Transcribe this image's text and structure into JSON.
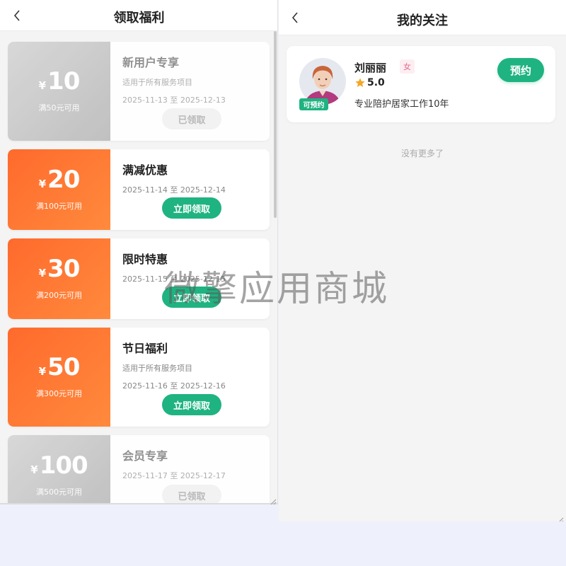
{
  "benefits_page": {
    "title": "领取福利",
    "coupons": [
      {
        "yen": "¥",
        "amount": "10",
        "condition": "满50元可用",
        "name": "新用户专享",
        "desc": "适用于所有服务项目",
        "date": "2025-11-13 至 2025-12-13",
        "button": "已领取",
        "state": "claimed"
      },
      {
        "yen": "¥",
        "amount": "20",
        "condition": "满100元可用",
        "name": "满减优惠",
        "desc": "",
        "date": "2025-11-14 至 2025-12-14",
        "button": "立即领取",
        "state": "active"
      },
      {
        "yen": "¥",
        "amount": "30",
        "condition": "满200元可用",
        "name": "限时特惠",
        "desc": "",
        "date": "2025-11-15 至 2025-12-15",
        "button": "立即领取",
        "state": "active"
      },
      {
        "yen": "¥",
        "amount": "50",
        "condition": "满300元可用",
        "name": "节日福利",
        "desc": "适用于所有服务项目",
        "date": "2025-11-16 至 2025-12-16",
        "button": "立即领取",
        "state": "active"
      },
      {
        "yen": "¥",
        "amount": "100",
        "condition": "满500元可用",
        "name": "会员专享",
        "desc": "",
        "date": "2025-11-17 至 2025-12-17",
        "button": "已领取",
        "state": "claimed"
      }
    ]
  },
  "follow_page": {
    "title": "我的关注",
    "card": {
      "name": "刘丽丽",
      "gender": "女",
      "rating": "5.0",
      "intro": "专业陪护居家工作10年",
      "badge": "可预约",
      "book_button": "预约"
    },
    "no_more": "没有更多了"
  },
  "watermark": "微擎应用商城",
  "colors": {
    "accent_green": "#1fb381",
    "coupon_orange": "#ff6a2c",
    "claimed_gray": "#c8c8c8",
    "star": "#f5a623"
  }
}
